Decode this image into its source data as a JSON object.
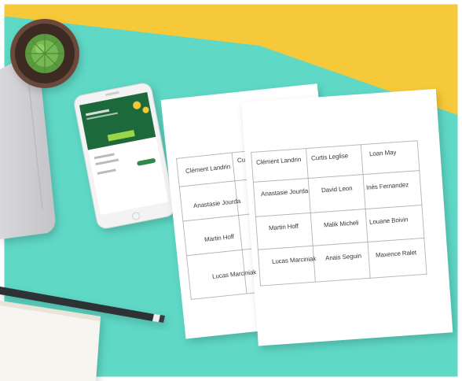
{
  "back_sheet": {
    "names": [
      "Clément Landrin",
      "Cu",
      "Anastasie Jourda",
      "Martin Hoff",
      "Lucas Marciniak"
    ]
  },
  "front_sheet": {
    "names": [
      [
        "Clément Landrin",
        "Curtis Leglise",
        "Loan May"
      ],
      [
        "Anastasie Jourda",
        "David Leon",
        "Inès Fernandez"
      ],
      [
        "Martin Hoff",
        "Malik Micheli",
        "Louane Boivin"
      ],
      [
        "Lucas Marciniak",
        "Anais Seguin",
        "Maxence Ralet"
      ]
    ]
  },
  "colors": {
    "mint": "#5fd8c6",
    "yellow": "#f6c93a",
    "paper": "#ffffff",
    "phone_screen_green": "#1e6a3a"
  }
}
